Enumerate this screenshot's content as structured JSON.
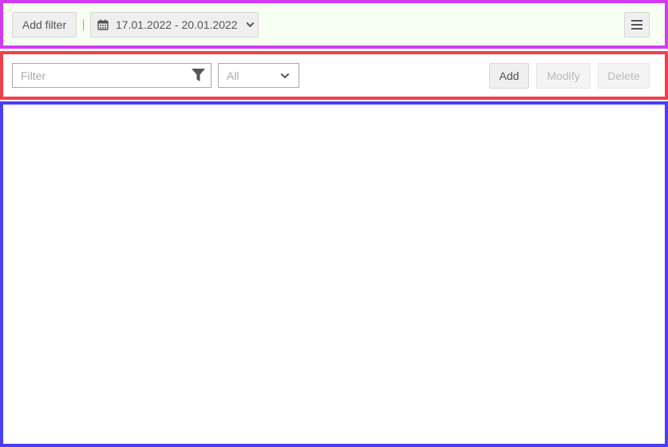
{
  "top_toolbar": {
    "add_filter_label": "Add filter",
    "date_range_label": "17.01.2022 - 20.01.2022",
    "date_icon": "calendar-icon",
    "dropdown_icon": "chevron-down-icon",
    "menu_icon": "hamburger-menu-icon"
  },
  "filter_toolbar": {
    "filter_placeholder": "Filter",
    "filter_value": "",
    "filter_icon": "funnel-icon",
    "select_value": "All",
    "add_label": "Add",
    "modify_label": "Modify",
    "delete_label": "Delete"
  },
  "colors": {
    "top_border": "#d23bf2",
    "top_background": "#f6fff1",
    "filter_border": "#f0404c",
    "content_border": "#4a3ff7"
  }
}
